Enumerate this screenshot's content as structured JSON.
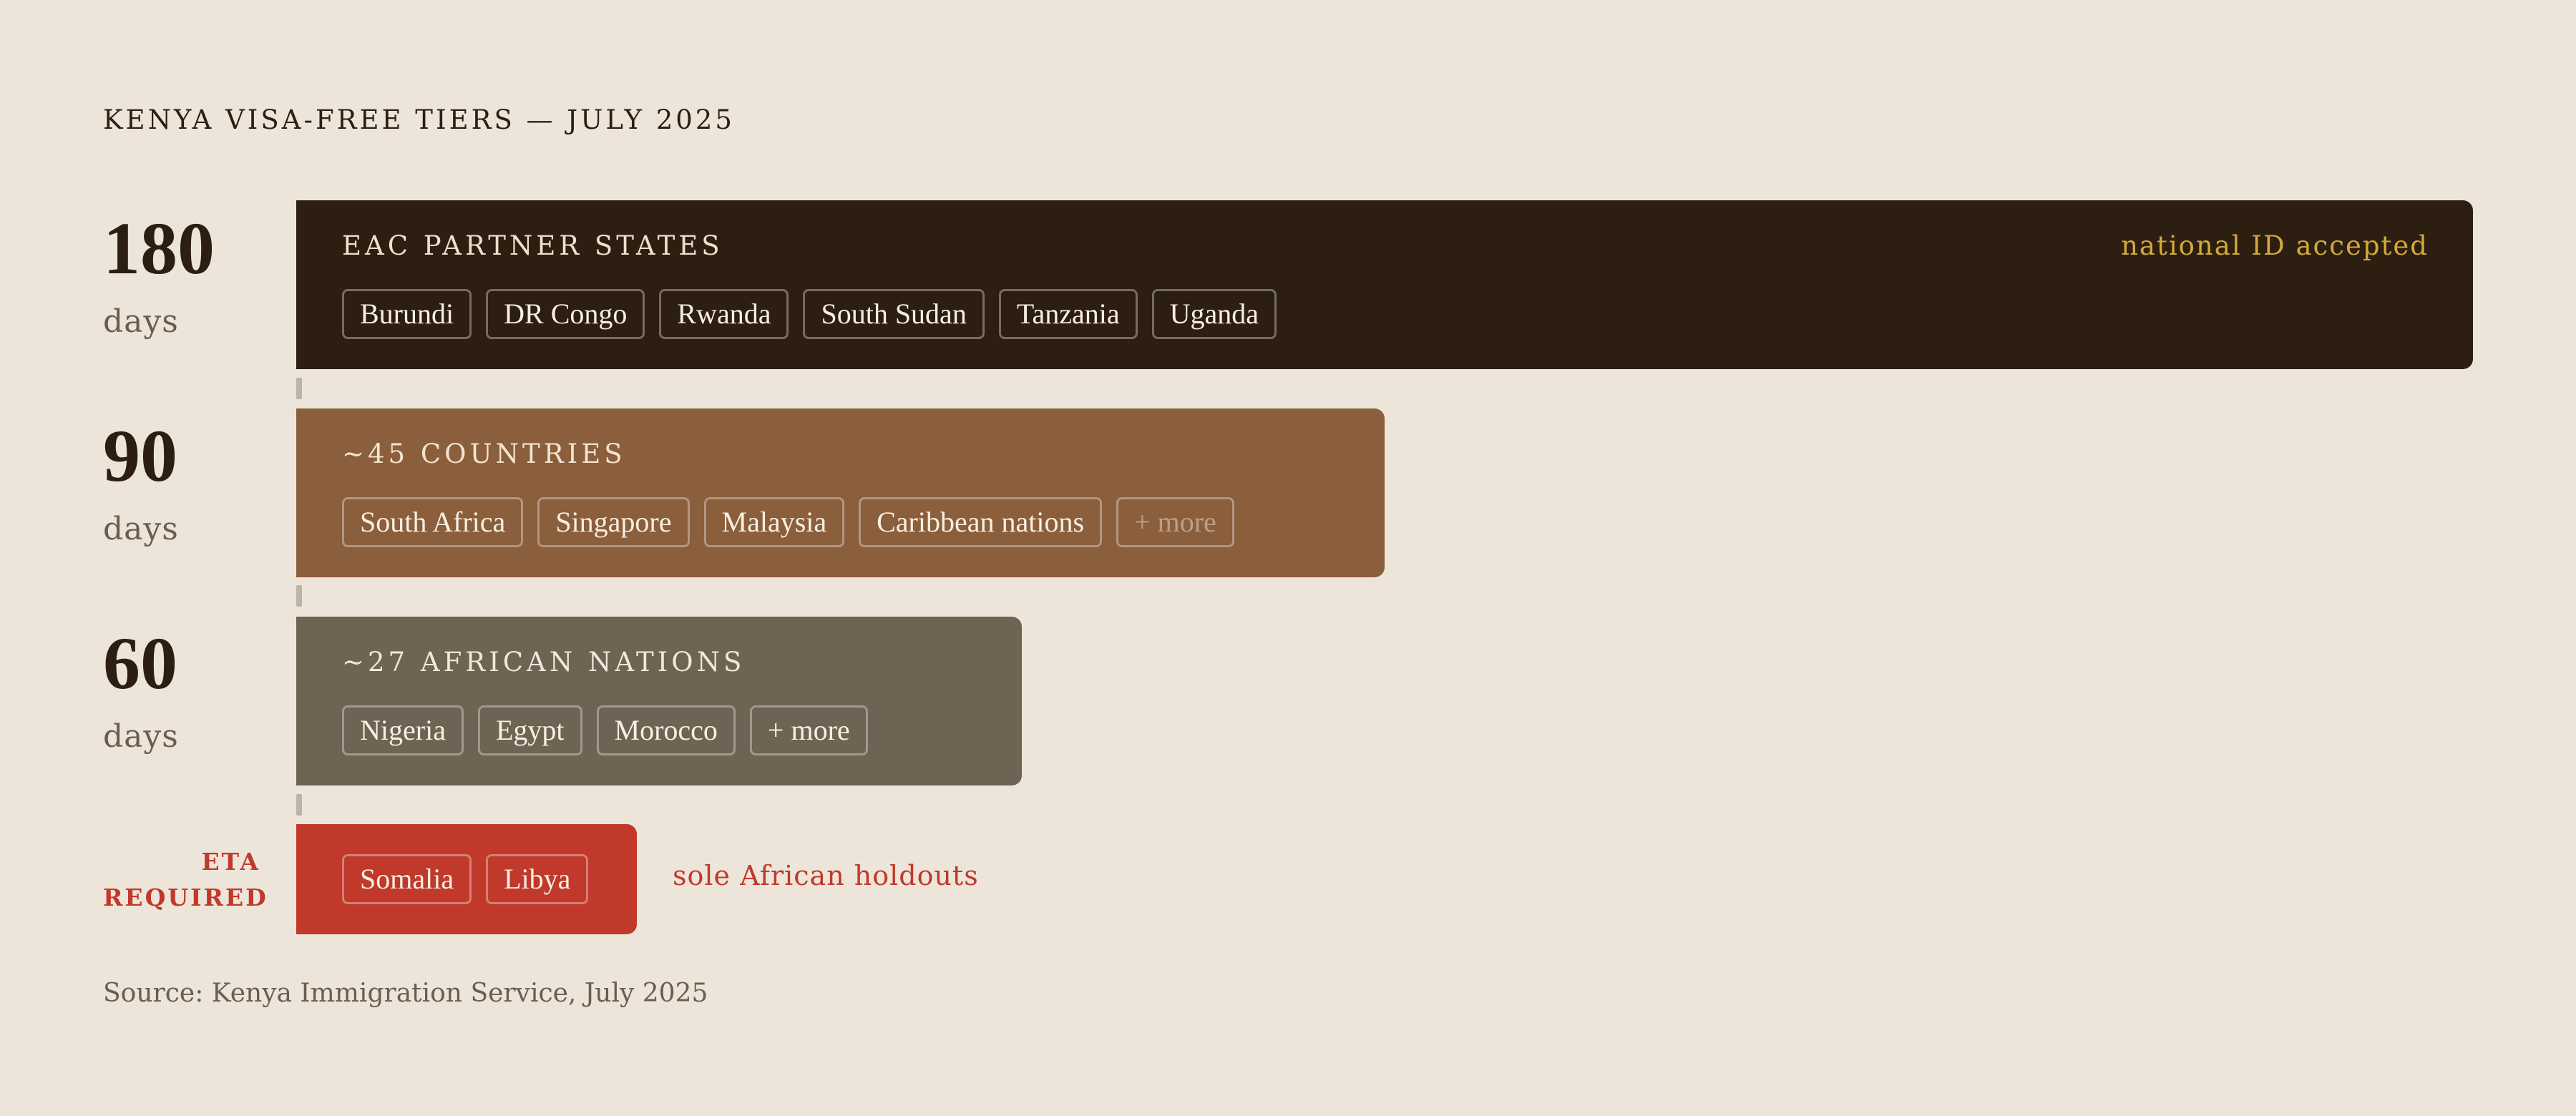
{
  "title": "KENYA VISA-FREE TIERS — JULY 2025",
  "colors": {
    "background": "#EDE5D9",
    "tier_180": "#2C1E10",
    "tier_90": "#8B5E3C",
    "tier_60": "#6F6353",
    "eta": "#C0392B",
    "header_text": "#EDE0CC",
    "note_gold": "#D4A93A"
  },
  "chart_data": {
    "type": "bar",
    "orientation": "horizontal",
    "categories": [
      "180 days",
      "90 days",
      "60 days",
      "ETA REQUIRED"
    ],
    "values": [
      180,
      90,
      60,
      null
    ],
    "tiers": [
      {
        "value": "180",
        "unit": "days",
        "header": "EAC PARTNER STATES",
        "note": "national ID accepted",
        "chips": [
          "Burundi",
          "DR Congo",
          "Rwanda",
          "South Sudan",
          "Tanzania",
          "Uganda"
        ],
        "faded_chips": []
      },
      {
        "value": "90",
        "unit": "days",
        "header": "~45 COUNTRIES",
        "note": "",
        "chips": [
          "South Africa",
          "Singapore",
          "Malaysia",
          "Caribbean nations"
        ],
        "faded_chips": [
          "+ more"
        ]
      },
      {
        "value": "60",
        "unit": "days",
        "header": "~27 AFRICAN NATIONS",
        "note": "",
        "chips": [
          "Nigeria",
          "Egypt",
          "Morocco",
          "+ more"
        ],
        "faded_chips": []
      }
    ],
    "eta": {
      "label_line1": "ETA",
      "label_line2": "REQUIRED",
      "chips": [
        "Somalia",
        "Libya"
      ],
      "note": "sole African holdouts"
    }
  },
  "source": "Source: Kenya Immigration Service, July 2025"
}
